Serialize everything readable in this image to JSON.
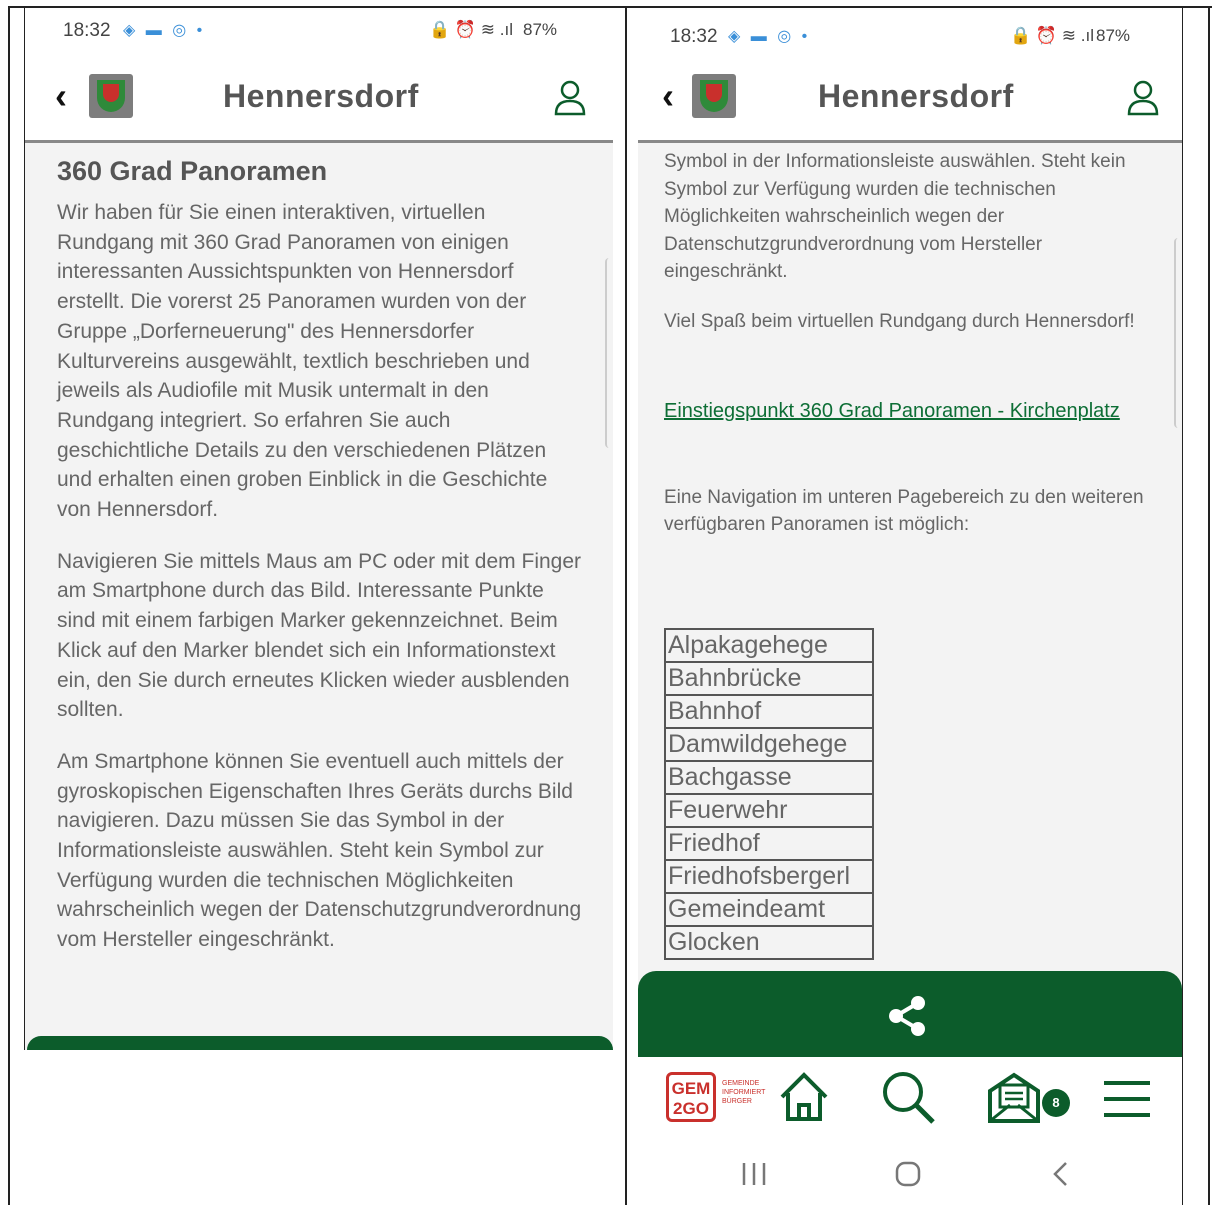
{
  "left_phone": {
    "status": {
      "time": "18:32",
      "left_icons": "◈ ▬ ◎ •",
      "right_info": "87%"
    },
    "appbar": {
      "title": "Hennersdorf"
    },
    "heading": "360 Grad Panoramen",
    "paragraphs": [
      "Wir haben für Sie einen interaktiven, virtuellen Rundgang mit 360 Grad Panoramen von einigen interessanten Aussichtspunkten von Hennersdorf erstellt. Die vorerst 25 Panoramen wurden von der Gruppe „Dorferneuerung\" des Hennersdorfer Kulturvereins ausgewählt, textlich beschrieben und jeweils als Audiofile mit Musik untermalt in den Rundgang integriert. So erfahren Sie auch geschichtliche Details zu den verschiedenen Plätzen und erhalten einen groben Einblick in die Geschichte von Hennersdorf.",
      "Navigieren Sie mittels Maus am PC oder mit dem Finger am Smartphone durch das Bild. Interessante Punkte sind mit einem farbigen Marker gekennzeichnet. Beim Klick auf den Marker blendet sich ein Informationstext ein, den Sie durch erneutes Klicken wieder ausblenden sollten.",
      "Am Smartphone können Sie eventuell auch mittels der gyroskopischen Eigenschaften Ihres Geräts durchs Bild navigieren. Dazu müssen Sie das Symbol in der Informationsleiste auswählen. Steht kein Symbol zur Verfügung wurden die technischen Möglichkeiten wahrscheinlich wegen der Datenschutzgrundverordnung vom Hersteller eingeschränkt."
    ]
  },
  "right_phone": {
    "status": {
      "time": "18:32",
      "left_icons": "◈ ▬ ◎ •",
      "right_info": "87%"
    },
    "appbar": {
      "title": "Hennersdorf"
    },
    "paragraphs": [
      "Symbol in der Informationsleiste auswählen. Steht kein Symbol zur Verfügung wurden die technischen Möglichkeiten wahrscheinlich wegen der Datenschutzgrundverordnung vom Hersteller eingeschränkt.",
      "Viel Spaß beim virtuellen Rundgang durch Hennersdorf!"
    ],
    "link": "Einstiegspunkt 360 Grad Panoramen - Kirchenplatz",
    "nav_intro": "Eine Navigation im unteren Pagebereich zu den weiteren verfügbaren Panoramen ist möglich:",
    "panoramas": [
      "Alpakagehege",
      "Bahnbrücke",
      "Bahnhof",
      "Damwildgehege",
      "Bachgasse",
      "Feuerwehr",
      "Friedhof",
      "Friedhofsbergerl",
      "Gemeindeamt",
      "Glocken"
    ],
    "bottom_nav": {
      "logo_text": "GEM 2GO",
      "logo_tagline": "GEMEINDE INFORMIERT BÜRGER",
      "badge_count": "8"
    }
  },
  "colors": {
    "brand_green": "#0c5c2b",
    "link_green": "#0d6e35",
    "logo_red": "#c9302c"
  }
}
